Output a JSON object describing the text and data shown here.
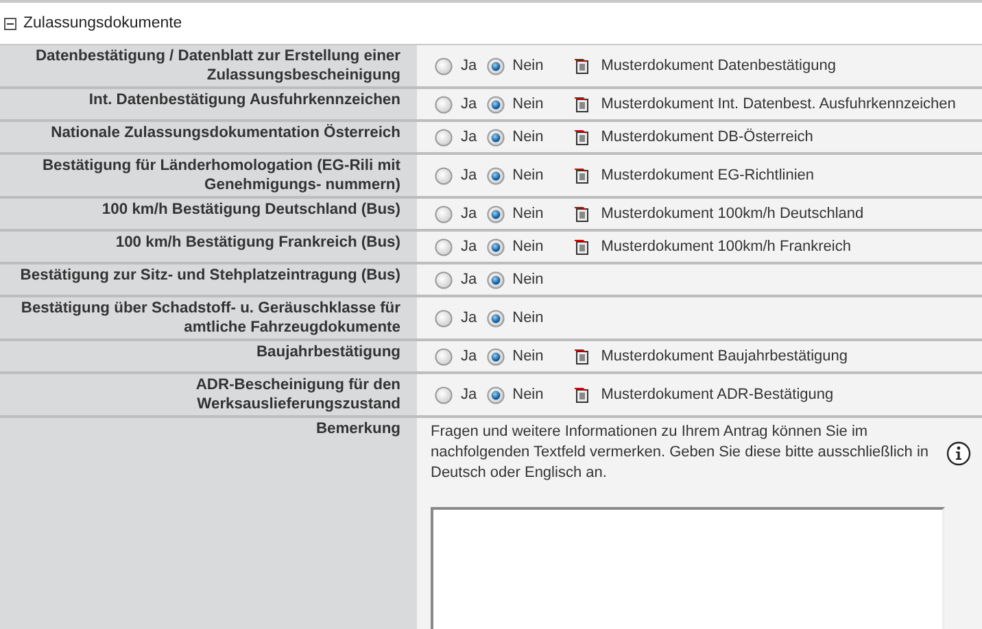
{
  "section": {
    "title": "Zulassungsdokumente",
    "expanded": true
  },
  "rows": [
    {
      "label": "Datenbestätigung / Datenblatt zur Erstellung einer Zulassungsbescheinigung",
      "options": [
        {
          "label": "Ja",
          "selected": false
        },
        {
          "label": "Nein",
          "selected": true
        }
      ],
      "document": "Musterdokument Datenbestätigung"
    },
    {
      "label": "Int. Datenbestätigung Ausfuhrkennzeichen",
      "options": [
        {
          "label": "Ja",
          "selected": false
        },
        {
          "label": "Nein",
          "selected": true
        }
      ],
      "document": "Musterdokument Int. Datenbest. Ausfuhrkennzeichen"
    },
    {
      "label": "Nationale Zulassungsdokumentation Österreich",
      "options": [
        {
          "label": "Ja",
          "selected": false
        },
        {
          "label": "Nein",
          "selected": true
        }
      ],
      "document": "Musterdokument DB-Österreich"
    },
    {
      "label": "Bestätigung für Länderhomologation (EG-Rili mit Genehmigungs- nummern)",
      "options": [
        {
          "label": "Ja",
          "selected": false
        },
        {
          "label": "Nein",
          "selected": true
        }
      ],
      "document": "Musterdokument EG-Richtlinien"
    },
    {
      "label": "100 km/h Bestätigung Deutschland (Bus)",
      "options": [
        {
          "label": "Ja",
          "selected": false
        },
        {
          "label": "Nein",
          "selected": true
        }
      ],
      "document": "Musterdokument 100km/h Deutschland"
    },
    {
      "label": "100 km/h Bestätigung Frankreich (Bus)",
      "options": [
        {
          "label": "Ja",
          "selected": false
        },
        {
          "label": "Nein",
          "selected": true
        }
      ],
      "document": "Musterdokument 100km/h Frankreich"
    },
    {
      "label": "Bestätigung zur Sitz- und Stehplatzeintragung (Bus)",
      "options": [
        {
          "label": "Ja",
          "selected": false
        },
        {
          "label": "Nein",
          "selected": true
        }
      ]
    },
    {
      "label": "Bestätigung über Schadstoff- u. Geräuschklasse für amtliche Fahrzeugdokumente",
      "options": [
        {
          "label": "Ja",
          "selected": false
        },
        {
          "label": "Nein",
          "selected": true
        }
      ]
    },
    {
      "label": "Baujahrbestätigung",
      "options": [
        {
          "label": "Ja",
          "selected": false
        },
        {
          "label": "Nein",
          "selected": true
        }
      ],
      "document": "Musterdokument Baujahrbestätigung"
    },
    {
      "label": "ADR-Bescheinigung für den Werksauslieferungszustand",
      "options": [
        {
          "label": "Ja",
          "selected": false
        },
        {
          "label": "Nein",
          "selected": true
        }
      ],
      "document": "Musterdokument ADR-Bestätigung"
    }
  ],
  "remark": {
    "label": "Bemerkung",
    "hint": "Fragen und weitere Informationen zu Ihrem Antrag können Sie im nachfolgenden Textfeld vermerken. Geben Sie diese bitte ausschließlich in Deutsch oder Englisch an."
  }
}
